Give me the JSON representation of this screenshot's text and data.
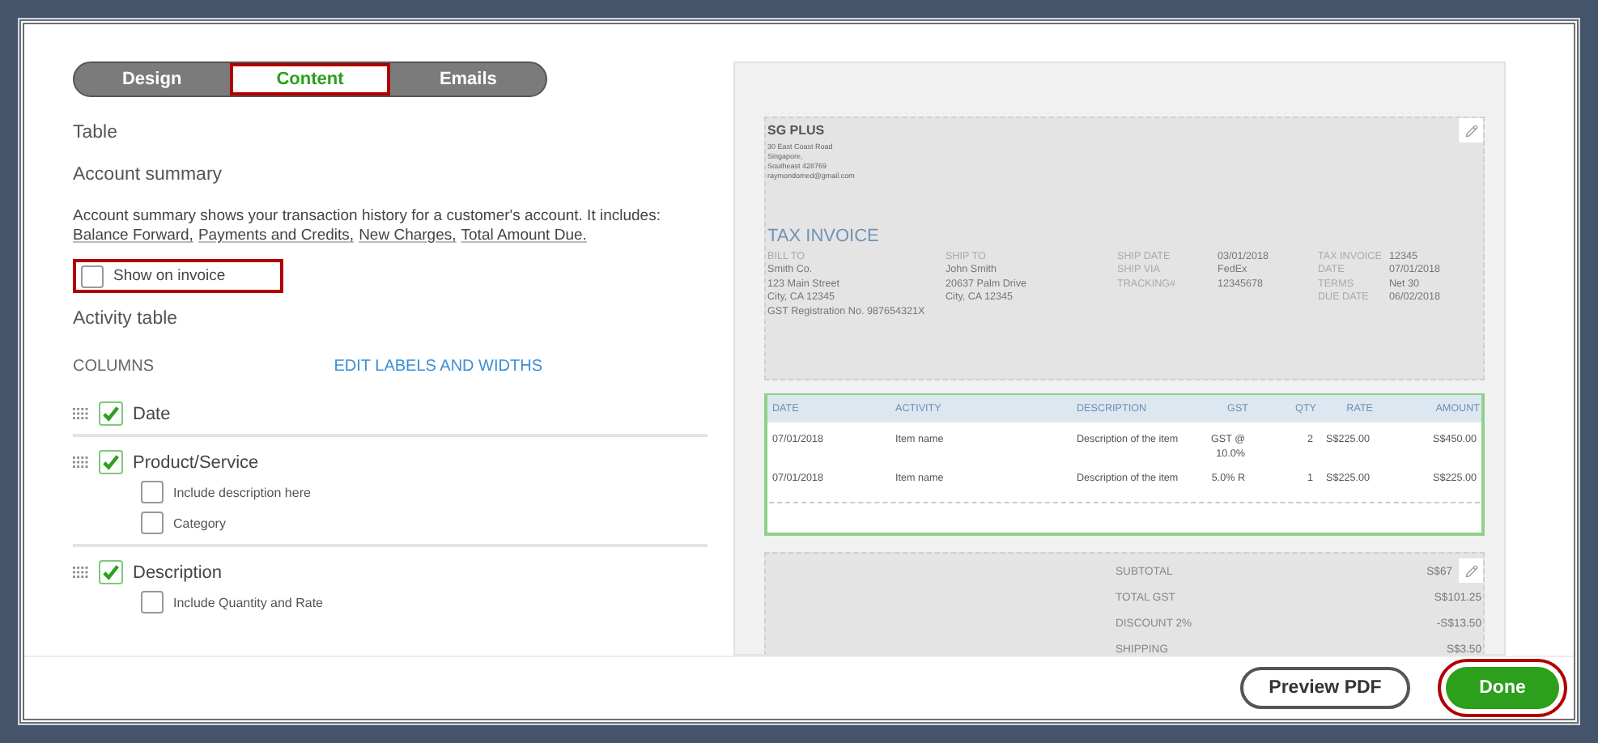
{
  "tabs": [
    {
      "label": "Design",
      "selected": false,
      "highlighted": false
    },
    {
      "label": "Content",
      "selected": true,
      "highlighted": true
    },
    {
      "label": "Emails",
      "selected": false,
      "highlighted": false
    }
  ],
  "section_title": "Table",
  "account_summary": {
    "title": "Account summary",
    "text": "Account summary shows your transaction history for a customer's account. It includes:",
    "links": [
      "Balance Forward,",
      "Payments and Credits,",
      "New Charges,",
      "Total Amount Due."
    ],
    "show_on_invoice": {
      "label": "Show on invoice",
      "checked": false,
      "highlighted": true
    }
  },
  "activity_table": {
    "title": "Activity table",
    "columns_label": "COLUMNS",
    "edit_link": "EDIT LABELS AND WIDTHS",
    "columns": [
      {
        "label": "Date",
        "checked": true
      },
      {
        "label": "Product/Service",
        "checked": true,
        "options": [
          {
            "label": "Include description here",
            "checked": false
          },
          {
            "label": "Category",
            "checked": false
          }
        ]
      },
      {
        "label": "Description",
        "checked": true,
        "options": [
          {
            "label": "Include Quantity and Rate",
            "checked": false
          }
        ]
      }
    ]
  },
  "preview": {
    "company": {
      "name": "SG PLUS",
      "lines": [
        "30 East Coast Road",
        "Singapore,",
        "Southeast 428769",
        "raymondomed@gmail.com"
      ]
    },
    "title": "TAX INVOICE",
    "bill_to": {
      "label": "BILL TO",
      "lines": [
        "Smith Co.",
        "123 Main Street",
        "City, CA 12345",
        "GST Registration No. 987654321X"
      ]
    },
    "ship_to": {
      "label": "SHIP TO",
      "lines": [
        "John Smith",
        "20637 Palm Drive",
        "City, CA 12345"
      ]
    },
    "shipping": [
      {
        "label": "SHIP DATE",
        "value": "03/01/2018"
      },
      {
        "label": "SHIP VIA",
        "value": "FedEx"
      },
      {
        "label": "TRACKING#",
        "value": "12345678"
      }
    ],
    "invoice": [
      {
        "label": "TAX INVOICE",
        "value": "12345"
      },
      {
        "label": "DATE",
        "value": "07/01/2018"
      },
      {
        "label": "TERMS",
        "value": "Net 30"
      },
      {
        "label": "DUE DATE",
        "value": "06/02/2018"
      }
    ],
    "table": {
      "columns": [
        "DATE",
        "ACTIVITY",
        "DESCRIPTION",
        "GST",
        "QTY",
        "RATE",
        "AMOUNT"
      ],
      "rows": [
        [
          "07/01/2018",
          "Item name",
          "Description of the item",
          "GST @ 10.0%",
          "2",
          "S$225.00",
          "S$450.00"
        ],
        [
          "07/01/2018",
          "Item name",
          "Description of the item",
          "5.0% R",
          "1",
          "S$225.00",
          "S$225.00"
        ]
      ]
    },
    "totals": [
      {
        "label": "SUBTOTAL",
        "value": "S$67"
      },
      {
        "label": "TOTAL GST",
        "value": "S$101.25"
      },
      {
        "label": "DISCOUNT 2%",
        "value": "-S$13.50"
      },
      {
        "label": "SHIPPING",
        "value": "S$3.50"
      }
    ]
  },
  "buttons": [
    {
      "label": "Preview PDF",
      "kind": "secondary",
      "highlighted": false
    },
    {
      "label": "Done",
      "kind": "primary",
      "highlighted": true
    }
  ]
}
